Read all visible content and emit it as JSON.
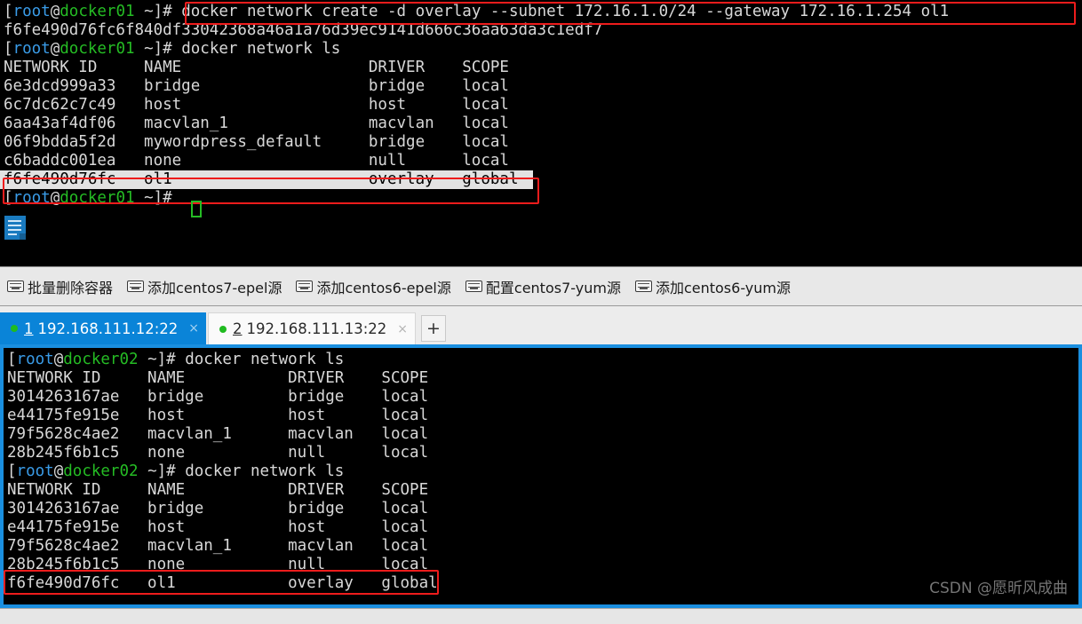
{
  "window": {
    "watermark": "CSDN @愿昕风成曲"
  },
  "top_terminal": {
    "host": "docker01",
    "lines": [
      {
        "type": "prompt",
        "user": "root",
        "at": "@",
        "host": "docker01",
        "tail": " ~]# ",
        "cmd": "docker network create -d overlay --subnet 172.16.1.0/24 --gateway 172.16.1.254 ol1"
      },
      {
        "type": "plain",
        "text": "f6fe490d76fc6f840df33042368a46a1a76d39ec9141d666c36aa63da3c1edf7"
      },
      {
        "type": "prompt",
        "user": "root",
        "at": "@",
        "host": "docker01",
        "tail": " ~]# ",
        "cmd": "docker network ls"
      },
      {
        "type": "plain",
        "text": "NETWORK ID     NAME                    DRIVER    SCOPE"
      },
      {
        "type": "plain",
        "text": "6e3dcd999a33   bridge                  bridge    local"
      },
      {
        "type": "plain",
        "text": "6c7dc62c7c49   host                    host      local"
      },
      {
        "type": "plain",
        "text": "6aa43af4df06   macvlan_1               macvlan   local"
      },
      {
        "type": "plain",
        "text": "06f9bdda5f2d   mywordpress_default     bridge    local"
      },
      {
        "type": "plain",
        "text": "c6baddc001ea   none                    null      local"
      },
      {
        "type": "selected",
        "text": "f6fe490d76fc   ol1                     overlay   global"
      },
      {
        "type": "prompt",
        "user": "root",
        "at": "@",
        "host": "docker01",
        "tail": " ~]# ",
        "cmd": ""
      }
    ]
  },
  "toolbar": {
    "items": [
      {
        "icon": "keyboard-icon",
        "label": "批量删除容器"
      },
      {
        "icon": "keyboard-icon",
        "label": "添加centos7-epel源"
      },
      {
        "icon": "keyboard-icon",
        "label": "添加centos6-epel源"
      },
      {
        "icon": "keyboard-icon",
        "label": "配置centos7-yum源"
      },
      {
        "icon": "keyboard-icon",
        "label": "添加centos6-yum源"
      }
    ]
  },
  "tabs": {
    "items": [
      {
        "num": "1",
        "label": "192.168.111.12:22",
        "active": true,
        "close": "×",
        "status_color": "#20bb20"
      },
      {
        "num": "2",
        "label": "192.168.111.13:22",
        "active": false,
        "close": "×",
        "status_color": "#20bb20"
      }
    ],
    "new_tab_label": "+"
  },
  "bottom_terminal": {
    "host": "docker02",
    "lines": [
      {
        "type": "prompt",
        "user": "root",
        "at": "@",
        "host": "docker02",
        "tail": " ~]# ",
        "cmd": "docker network ls"
      },
      {
        "type": "plain",
        "text": "NETWORK ID     NAME           DRIVER    SCOPE"
      },
      {
        "type": "plain",
        "text": "3014263167ae   bridge         bridge    local"
      },
      {
        "type": "plain",
        "text": "e44175fe915e   host           host      local"
      },
      {
        "type": "plain",
        "text": "79f5628c4ae2   macvlan_1      macvlan   local"
      },
      {
        "type": "plain",
        "text": "28b245f6b1c5   none           null      local"
      },
      {
        "type": "prompt",
        "user": "root",
        "at": "@",
        "host": "docker02",
        "tail": " ~]# ",
        "cmd": "docker network ls"
      },
      {
        "type": "plain",
        "text": "NETWORK ID     NAME           DRIVER    SCOPE"
      },
      {
        "type": "plain",
        "text": "3014263167ae   bridge         bridge    local"
      },
      {
        "type": "plain",
        "text": "e44175fe915e   host           host      local"
      },
      {
        "type": "plain",
        "text": "79f5628c4ae2   macvlan_1      macvlan   local"
      },
      {
        "type": "plain",
        "text": "28b245f6b1c5   none           null      local"
      },
      {
        "type": "plain",
        "text": "f6fe490d76fc   ol1            overlay   global"
      }
    ]
  },
  "colors": {
    "prompt_user": "#3a9ce8",
    "prompt_host": "#25bc24",
    "prompt_tilde": "#4fc3d8",
    "bracket_red": "#e05050",
    "terminal_fg": "#d8d8d8",
    "terminal_bg": "#000000",
    "annotation_red": "#ee1c1c",
    "tab_active_bg": "#0a84d8",
    "panel_border_blue": "#1a8fe0",
    "cursor_green": "#25bc24",
    "selection_bg": "#e2e2e2"
  }
}
